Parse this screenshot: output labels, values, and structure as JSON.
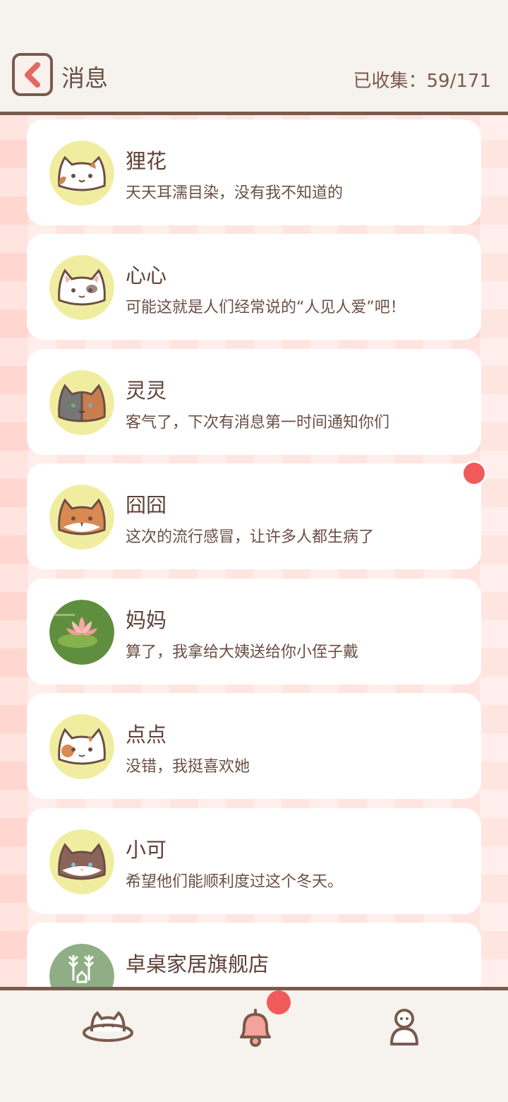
{
  "header": {
    "title": "消息",
    "collected": "已收集：59/171"
  },
  "messages": [
    {
      "name": "狸花",
      "message": "天天耳濡目染，没有我不知道的",
      "avatar": "calico-cat-icon"
    },
    {
      "name": "心心",
      "message": "可能这就是人们经常说的“人见人爱”吧！",
      "avatar": "white-cat-icon"
    },
    {
      "name": "灵灵",
      "message": "客气了，下次有消息第一时间通知你们",
      "avatar": "split-face-cat-icon"
    },
    {
      "name": "囧囧",
      "message": "这次的流行感冒，让许多人都生病了",
      "avatar": "orange-cat-icon",
      "unread": true
    },
    {
      "name": "妈妈",
      "message": "算了，我拿给大姨送给你小侄子戴",
      "avatar": "lotus-icon"
    },
    {
      "name": "点点",
      "message": "没错，我挺喜欢她",
      "avatar": "spotted-cat-icon"
    },
    {
      "name": "小可",
      "message": "希望他们能顺利度过这个冬天。",
      "avatar": "brown-cat-icon"
    },
    {
      "name": "卓桌家居旗舰店",
      "message": "",
      "avatar": "shop-tree-icon"
    }
  ],
  "nav": [
    {
      "icon": "cat-planet-icon"
    },
    {
      "icon": "bell-icon",
      "badge": true
    },
    {
      "icon": "person-icon"
    }
  ],
  "colors": {
    "accent_brown": "#7a5a4d",
    "badge_red": "#f15a5a",
    "avatar_yellow": "#f1eda0"
  }
}
